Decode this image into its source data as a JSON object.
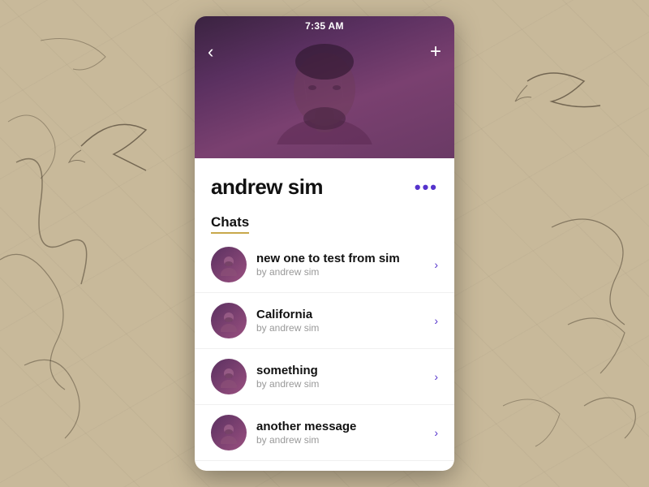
{
  "status_bar": {
    "time": "7:35 AM"
  },
  "nav": {
    "back_label": "‹",
    "add_label": "+"
  },
  "profile": {
    "name": "andrew sim",
    "more_label": "•••"
  },
  "chats_section": {
    "label": "Chats"
  },
  "chat_items": [
    {
      "id": 1,
      "title": "new one to test from sim",
      "subtitle": "by andrew sim"
    },
    {
      "id": 2,
      "title": "California",
      "subtitle": "by andrew sim"
    },
    {
      "id": 3,
      "title": "something",
      "subtitle": "by andrew sim"
    },
    {
      "id": 4,
      "title": "another message",
      "subtitle": "by andrew sim"
    }
  ],
  "colors": {
    "accent": "#5533cc",
    "gold": "#c8a84b",
    "photo_bg_top": "#3a2340",
    "photo_bg_bottom": "#6a3a65"
  }
}
